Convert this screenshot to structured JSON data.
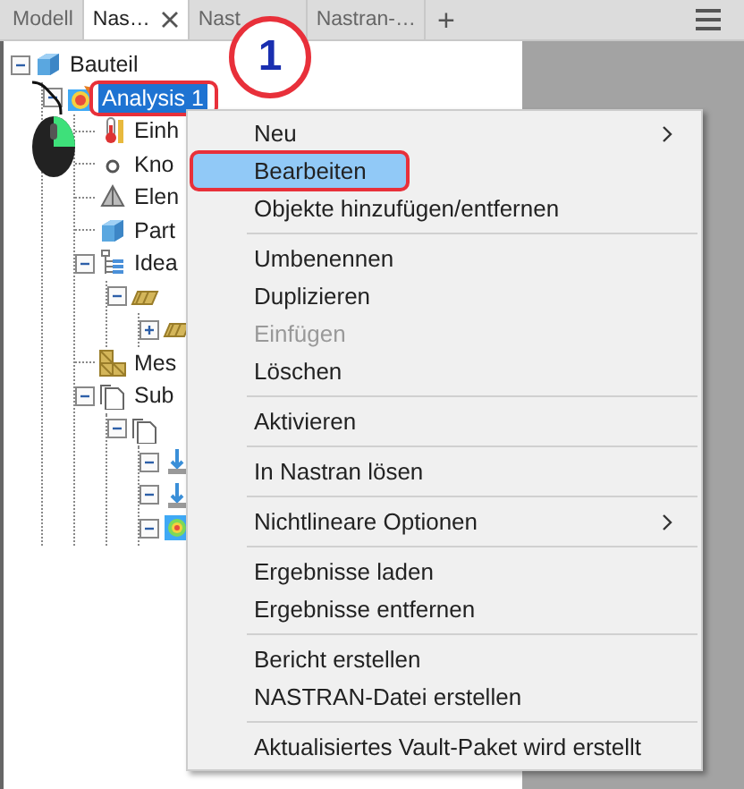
{
  "tabs": [
    {
      "label": "Modell",
      "selected": false,
      "closable": false
    },
    {
      "label": "Nas…",
      "selected": true,
      "closable": true
    },
    {
      "label": "Nast",
      "selected": false,
      "closable": false
    },
    {
      "label": "Nastran-…",
      "selected": false,
      "closable": false
    }
  ],
  "tab_add": "+",
  "tree": [
    {
      "label": "Bauteil",
      "kind": "cube",
      "expanded": true,
      "selected": false,
      "children": [
        {
          "label": "Analysis 1",
          "kind": "analysis",
          "expanded": true,
          "selected": true,
          "children": [
            {
              "label": "Einh",
              "kind": "thermometer",
              "selected": false
            },
            {
              "label": "Kno",
              "kind": "node",
              "selected": false
            },
            {
              "label": "Elen",
              "kind": "element",
              "selected": false
            },
            {
              "label": "Part",
              "kind": "cube",
              "selected": false
            },
            {
              "label": "Idea",
              "kind": "hierarchy",
              "expanded": true,
              "selected": false,
              "children": [
                {
                  "kind": "plate",
                  "expanded": true,
                  "children": [
                    {
                      "kind": "plate",
                      "expanded": false
                    }
                  ]
                }
              ]
            },
            {
              "label": "Mes",
              "kind": "mesh",
              "selected": false
            },
            {
              "label": "Sub",
              "kind": "doc",
              "expanded": true,
              "selected": false,
              "children": [
                {
                  "kind": "doc",
                  "expanded": true,
                  "children": [
                    {
                      "kind": "load",
                      "expanded": true
                    },
                    {
                      "kind": "load",
                      "expanded": true
                    },
                    {
                      "kind": "result",
                      "expanded": true
                    }
                  ]
                }
              ]
            }
          ]
        }
      ]
    }
  ],
  "context_menu": [
    {
      "kind": "item",
      "label": "Neu",
      "submenu": true,
      "disabled": false,
      "selected": false
    },
    {
      "kind": "item",
      "label": "Bearbeiten",
      "submenu": false,
      "disabled": false,
      "selected": true
    },
    {
      "kind": "item",
      "label": "Objekte hinzufügen/entfernen",
      "submenu": false,
      "disabled": false,
      "selected": false
    },
    {
      "kind": "separator"
    },
    {
      "kind": "item",
      "label": "Umbenennen",
      "submenu": false,
      "disabled": false,
      "selected": false
    },
    {
      "kind": "item",
      "label": "Duplizieren",
      "submenu": false,
      "disabled": false,
      "selected": false
    },
    {
      "kind": "item",
      "label": "Einfügen",
      "submenu": false,
      "disabled": true,
      "selected": false
    },
    {
      "kind": "item",
      "label": "Löschen",
      "submenu": false,
      "disabled": false,
      "selected": false
    },
    {
      "kind": "separator"
    },
    {
      "kind": "item",
      "label": "Aktivieren",
      "submenu": false,
      "disabled": false,
      "selected": false
    },
    {
      "kind": "separator"
    },
    {
      "kind": "item",
      "label": "In Nastran lösen",
      "submenu": false,
      "disabled": false,
      "selected": false
    },
    {
      "kind": "separator"
    },
    {
      "kind": "item",
      "label": "Nichtlineare Optionen",
      "submenu": true,
      "disabled": false,
      "selected": false
    },
    {
      "kind": "separator"
    },
    {
      "kind": "item",
      "label": "Ergebnisse laden",
      "submenu": false,
      "disabled": false,
      "selected": false
    },
    {
      "kind": "item",
      "label": "Ergebnisse entfernen",
      "submenu": false,
      "disabled": false,
      "selected": false
    },
    {
      "kind": "separator"
    },
    {
      "kind": "item",
      "label": "Bericht erstellen",
      "submenu": false,
      "disabled": false,
      "selected": false
    },
    {
      "kind": "item",
      "label": "NASTRAN-Datei erstellen",
      "submenu": false,
      "disabled": false,
      "selected": false
    },
    {
      "kind": "separator"
    },
    {
      "kind": "item",
      "label": "Aktualisiertes Vault-Paket wird erstellt",
      "submenu": false,
      "disabled": false,
      "selected": false
    }
  ],
  "callout": "1"
}
